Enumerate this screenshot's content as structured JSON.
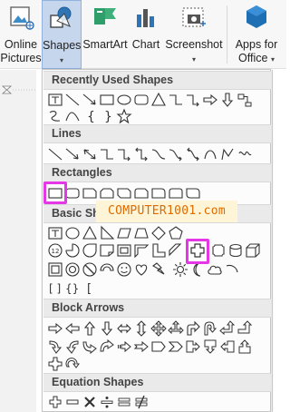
{
  "ribbon": {
    "online_pictures": "Online\nPictures",
    "online_pictures_l1": "Online",
    "online_pictures_l2": "Pictures",
    "shapes": "Shapes",
    "smartart": "SmartArt",
    "chart": "Chart",
    "screenshot": "Screenshot",
    "apps_l1": "Apps for",
    "apps_l2": "Office"
  },
  "sections": {
    "recent": "Recently Used Shapes",
    "lines": "Lines",
    "rectangles": "Rectangles",
    "basic": "Basic Shapes",
    "block_arrows": "Block Arrows",
    "equation": "Equation Shapes"
  },
  "watermark": "COMPUTER1001.com",
  "colors": {
    "highlight": "#e637e6",
    "active_button": "#c5d6ed",
    "accent_blue": "#2b579a"
  }
}
